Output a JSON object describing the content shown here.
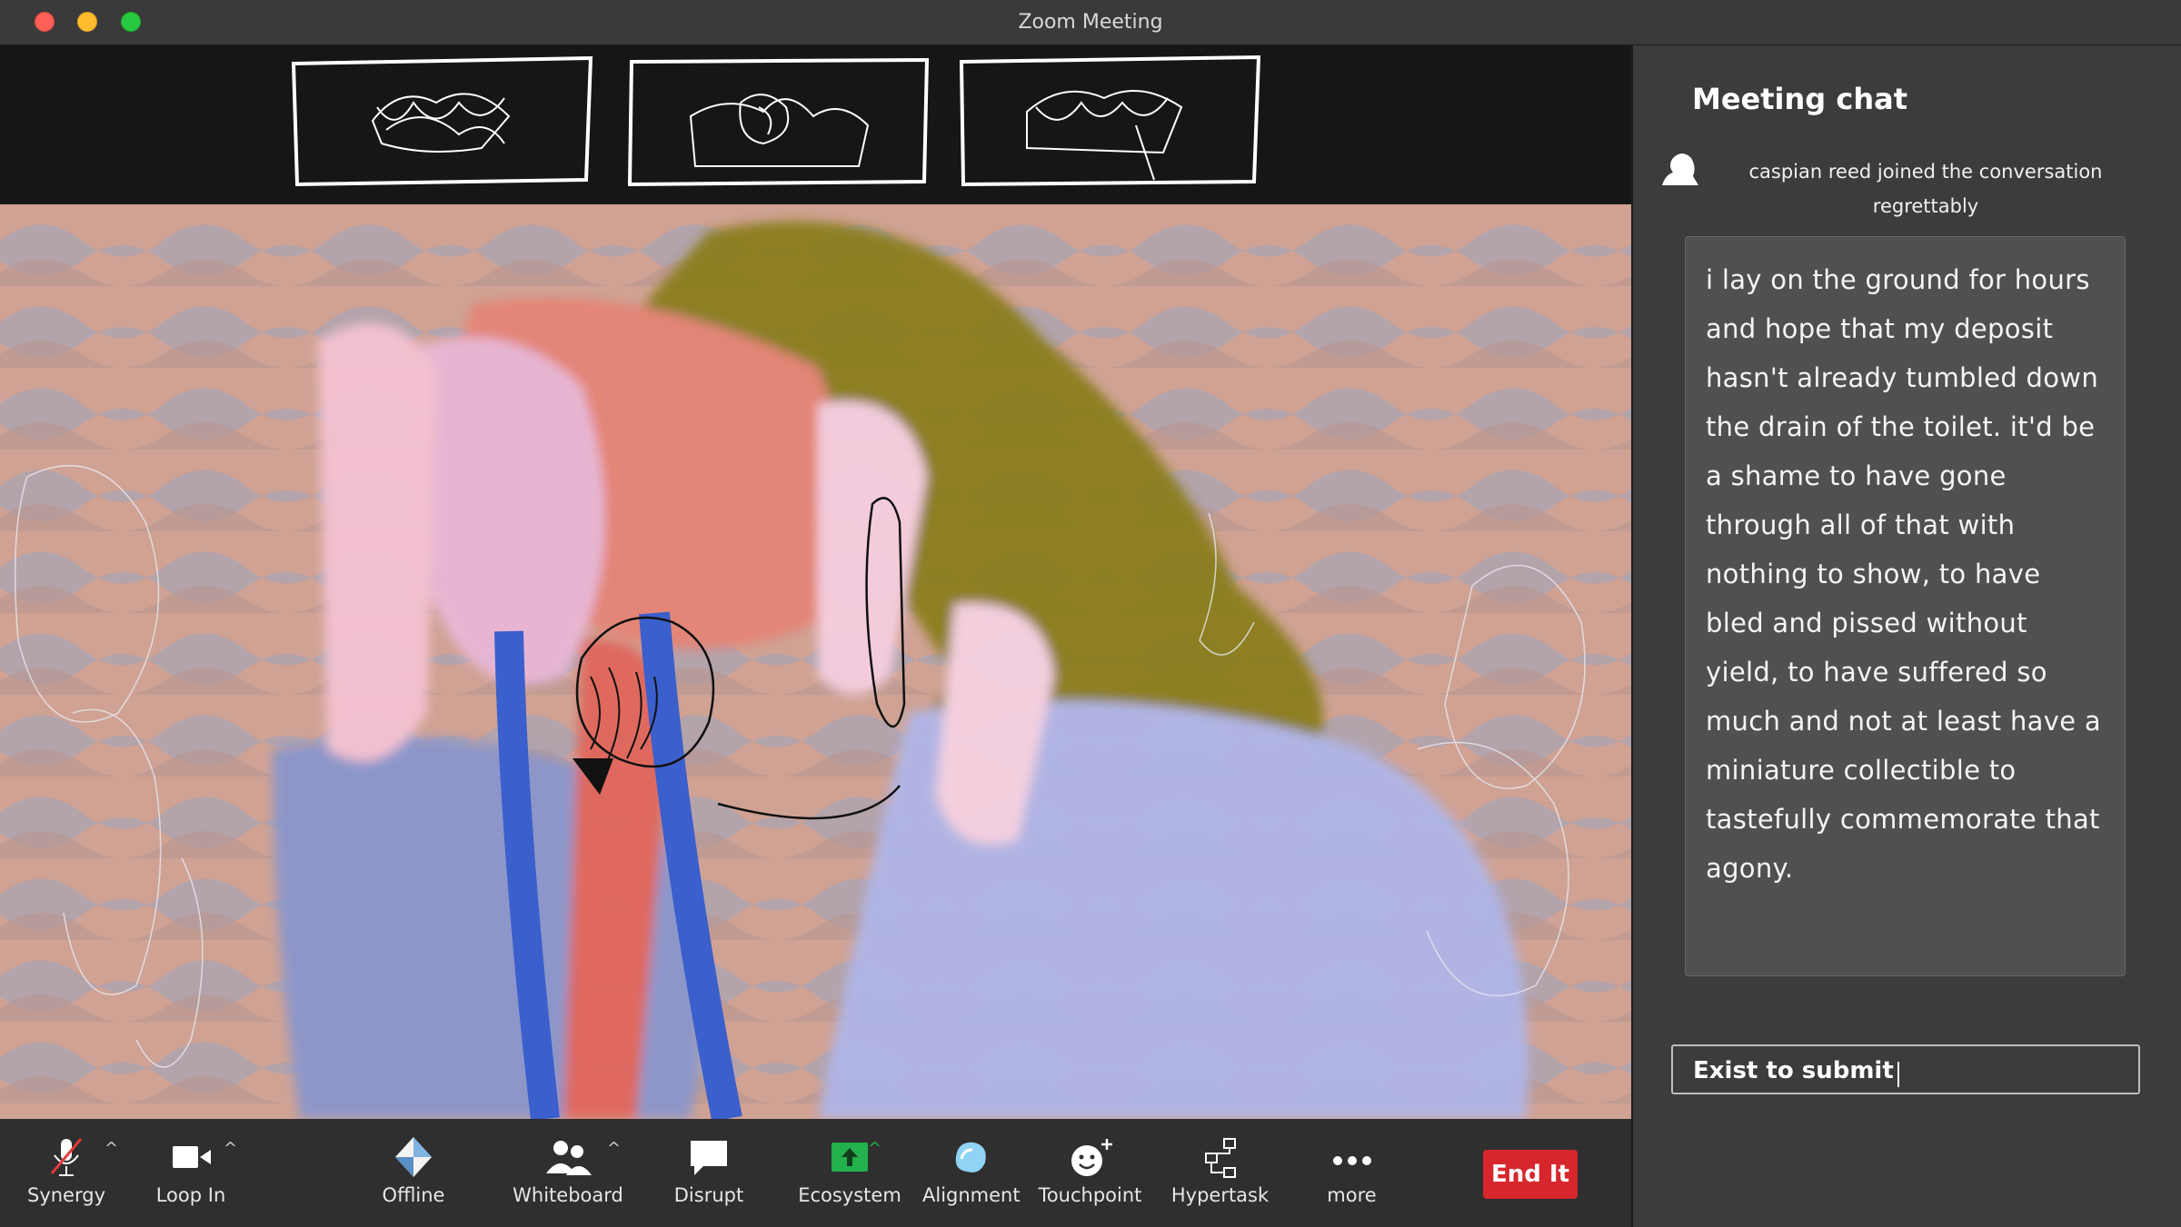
{
  "window": {
    "title": "Zoom Meeting"
  },
  "colors": {
    "accent_red": "#d7262c",
    "chat_bg": "#3c3c3c",
    "ecosystem_green": "#22b14c",
    "alignment_blue": "#8fd3f5"
  },
  "chat": {
    "title": "Meeting chat",
    "join_notice": "caspian reed joined the conversation regrettably",
    "message": "i lay on the ground for hours and hope that my deposit hasn't already tumbled down the drain of the toilet. it'd be a shame to have gone through all of that with nothing to show, to have bled and pissed without yield, to have suffered so much and not at least have a miniature collectible to tastefully commemorate that agony.",
    "input_value": "Exist to submit"
  },
  "toolbar": {
    "items": [
      {
        "label": "Synergy",
        "icon": "muted-microphone-icon"
      },
      {
        "label": "Loop In",
        "icon": "video-camera-icon"
      },
      {
        "label": "Offline",
        "icon": "diamond-icon"
      },
      {
        "label": "Whiteboard",
        "icon": "participants-icon"
      },
      {
        "label": "Disrupt",
        "icon": "speech-bubble-icon"
      },
      {
        "label": "Ecosystem",
        "icon": "share-screen-icon"
      },
      {
        "label": "Alignment",
        "icon": "blob-icon"
      },
      {
        "label": "Touchpoint",
        "icon": "smiley-plus-icon"
      },
      {
        "label": "Hypertask",
        "icon": "flowchart-icon"
      },
      {
        "label": "more",
        "icon": "more-dots-icon"
      }
    ],
    "end_label": "End It"
  }
}
